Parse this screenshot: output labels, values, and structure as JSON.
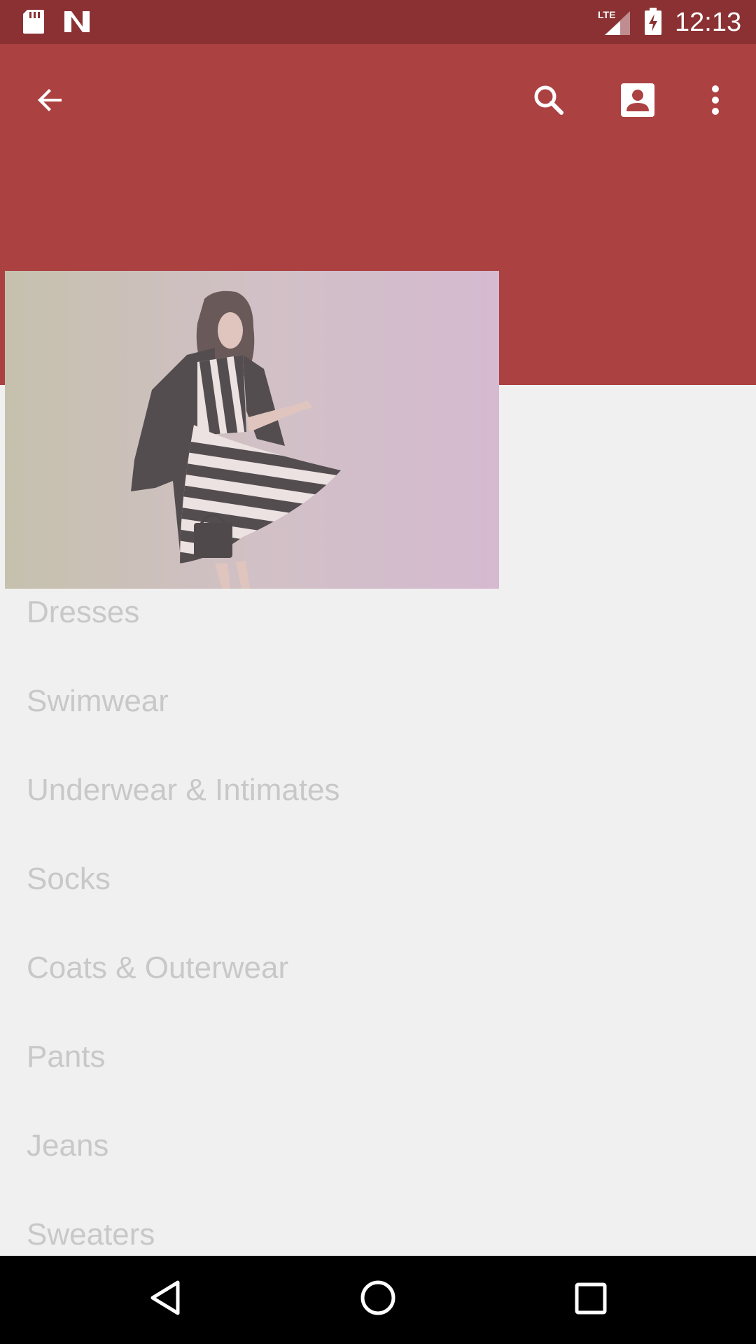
{
  "status_bar": {
    "time": "12:13",
    "network": "LTE",
    "icons": [
      "sd-card-icon",
      "n-notification-icon",
      "lte-signal-icon",
      "battery-charging-icon"
    ]
  },
  "toolbar": {
    "icons": [
      "back-arrow-icon",
      "search-icon",
      "account-icon",
      "overflow-menu-icon"
    ],
    "background": "#ac4142"
  },
  "hero": {
    "icon": "fashion-photo"
  },
  "categories": [
    "Dresses",
    "Swimwear",
    "Underwear & Intimates",
    "Socks",
    "Coats & Outerwear",
    "Pants",
    "Jeans",
    "Sweaters"
  ],
  "nav_bar": {
    "icons": [
      "nav-back-icon",
      "nav-home-icon",
      "nav-recents-icon"
    ]
  },
  "colors": {
    "status_bar": "#8b3133",
    "toolbar": "#ac4142",
    "list_background": "#f0f0f0",
    "list_text": "#c8c8c8"
  }
}
